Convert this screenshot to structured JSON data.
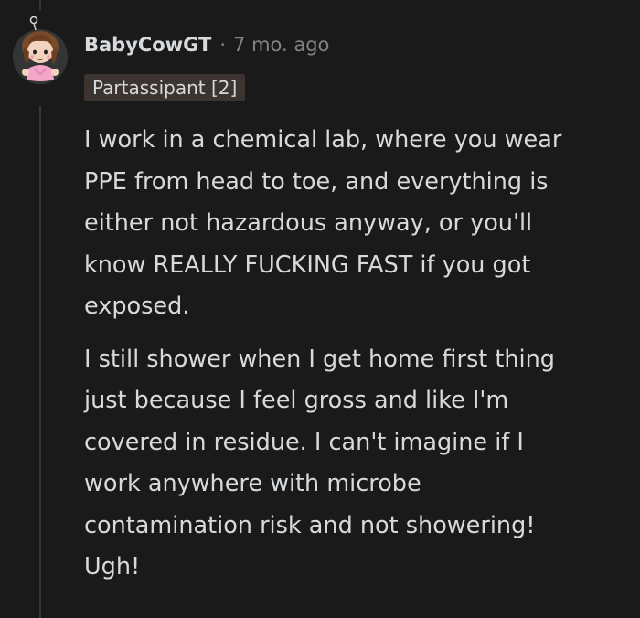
{
  "comment": {
    "author": "BabyCowGT",
    "separator": "·",
    "timestamp": "7 mo. ago",
    "flair": "Partassipant [2]",
    "paragraphs": [
      "I work in a chemical lab, where you wear\nPPE from head to toe, and everything is\neither not hazardous anyway, or you'll\nknow REALLY FUCKING FAST if you got\nexposed.",
      "I still shower when I get home first thing\njust because I feel gross and like I'm\ncovered in residue. I can't imagine if I\nwork anywhere with microbe\ncontamination risk and not showering!\nUgh!"
    ]
  },
  "colors": {
    "background": "#1a1a1b",
    "text": "#d7dadc",
    "muted": "#818384",
    "flair_bg": "#3c3430",
    "thread_line": "#343536"
  }
}
